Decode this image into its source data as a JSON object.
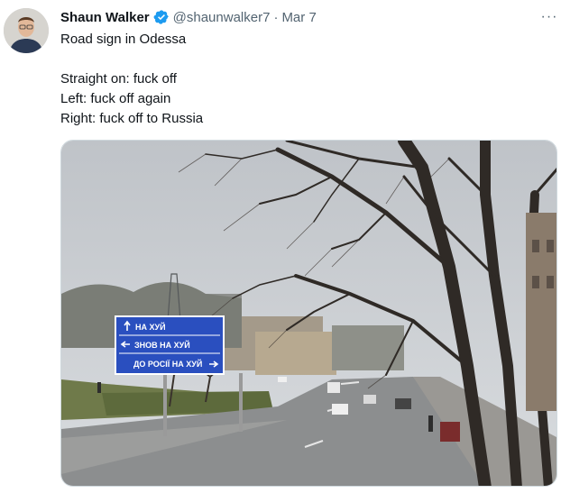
{
  "tweet": {
    "author_name": "Shaun Walker",
    "author_handle": "@shaunwalker7",
    "separator": "·",
    "date": "Mar 7",
    "more_label": "···",
    "text_lines": [
      "Road sign in Odessa",
      "",
      "Straight on: fuck off",
      "Left: fuck off again",
      "Right: fuck off to Russia"
    ]
  },
  "media": {
    "sign_lines": [
      "НА ХУЙ",
      "ЗНОВ НА ХУЙ",
      "ДО РОСІЇ НА ХУЙ"
    ],
    "sign_color": "#2a4fbf"
  },
  "colors": {
    "verified": "#1d9bf0",
    "secondary_text": "#536471"
  },
  "icons": {
    "verified": "verified-badge-icon",
    "more": "more-icon"
  }
}
